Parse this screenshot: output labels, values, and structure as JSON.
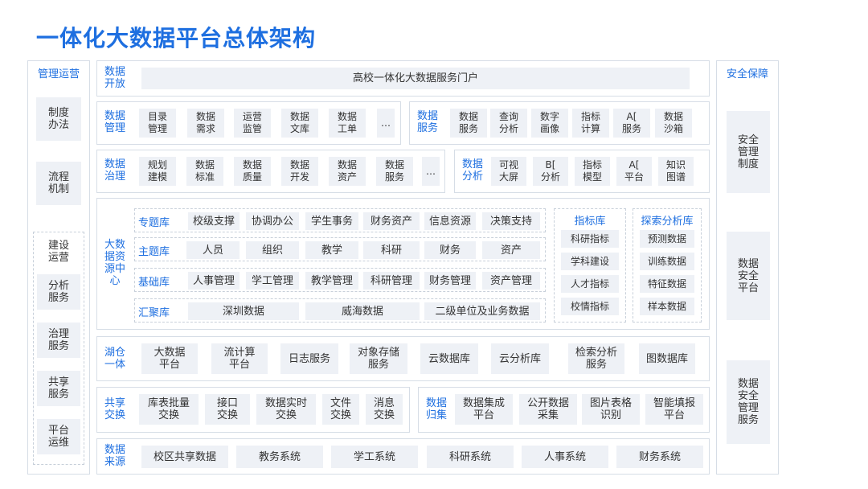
{
  "title": "一体化大数据平台总体架构",
  "left_column": {
    "heading": "管理运营",
    "items": [
      "制度\n办法",
      "流程\n机制"
    ],
    "group_items": [
      "建设\n运营",
      "分析\n服务",
      "治理\n服务",
      "共享\n服务",
      "平台\n运维"
    ]
  },
  "right_column": {
    "heading": "安全保障",
    "items": [
      "安全\n管理\n制度",
      "数据\n安全\n平台",
      "数据\n安全\n管理\n服务"
    ]
  },
  "open": {
    "label": "数据\n开放",
    "portal": "高校一体化大数据服务门户"
  },
  "management": {
    "label": "数据\n管理",
    "items": [
      "目录\n管理",
      "数据\n需求",
      "运营\n监管",
      "数据\n文库",
      "数据\n工单",
      "…"
    ]
  },
  "service": {
    "label": "数据\n服务",
    "items": [
      "数据\n服务",
      "查询\n分析",
      "数字\n画像",
      "指标\n计算",
      "A[\n服务",
      "数据\n沙箱"
    ]
  },
  "governance": {
    "label": "数据\n治理",
    "items": [
      "规划\n建模",
      "数据\n标准",
      "数据\n质量",
      "数据\n开发",
      "数据\n资产",
      "数据\n服务",
      "…"
    ]
  },
  "analysis": {
    "label": "数据\n分析",
    "items": [
      "可视\n大屏",
      "B[\n分析",
      "指标\n模型",
      "A[\n平台",
      "知识\n图谱"
    ]
  },
  "resource_center": {
    "label": "大数\n据资\n源中\n心",
    "rows": [
      {
        "name": "专题库",
        "items": [
          "校级支撑",
          "协调办公",
          "学生事务",
          "财务资产",
          "信息资源",
          "决策支持"
        ]
      },
      {
        "name": "主题库",
        "items": [
          "人员",
          "组织",
          "教学",
          "科研",
          "财务",
          "资产"
        ]
      },
      {
        "name": "基础库",
        "items": [
          "人事管理",
          "学工管理",
          "教学管理",
          "科研管理",
          "财务管理",
          "资产管理"
        ]
      },
      {
        "name": "汇聚库",
        "items": [
          "深圳数据",
          "威海数据",
          "二级单位及业务数据"
        ]
      }
    ],
    "indicator": {
      "heading": "指标库",
      "items": [
        "科研指标",
        "学科建设",
        "人才指标",
        "校情指标"
      ]
    },
    "explore": {
      "heading": "探索分析库",
      "items": [
        "预测数据",
        "训练数据",
        "特征数据",
        "样本数据"
      ]
    }
  },
  "lake": {
    "label": "湖仓\n一体",
    "items": [
      "大数据\n平台",
      "流计算\n平台",
      "日志服务",
      "对象存储\n服务",
      "云数据库",
      "云分析库",
      "检索分析\n服务",
      "图数据库"
    ]
  },
  "exchange": {
    "label": "共享\n交换",
    "items": [
      "库表批量\n交换",
      "接口\n交换",
      "数据实时\n交换",
      "文件\n交换",
      "消息\n交换"
    ]
  },
  "collect": {
    "label": "数据\n归集",
    "items": [
      "数据集成\n平台",
      "公开数据\n采集",
      "图片表格\n识别",
      "智能填报\n平台"
    ]
  },
  "source": {
    "label": "数据\n来源",
    "items": [
      "校区共享数据",
      "教务系统",
      "学工系统",
      "科研系统",
      "人事系统",
      "财务系统"
    ]
  }
}
